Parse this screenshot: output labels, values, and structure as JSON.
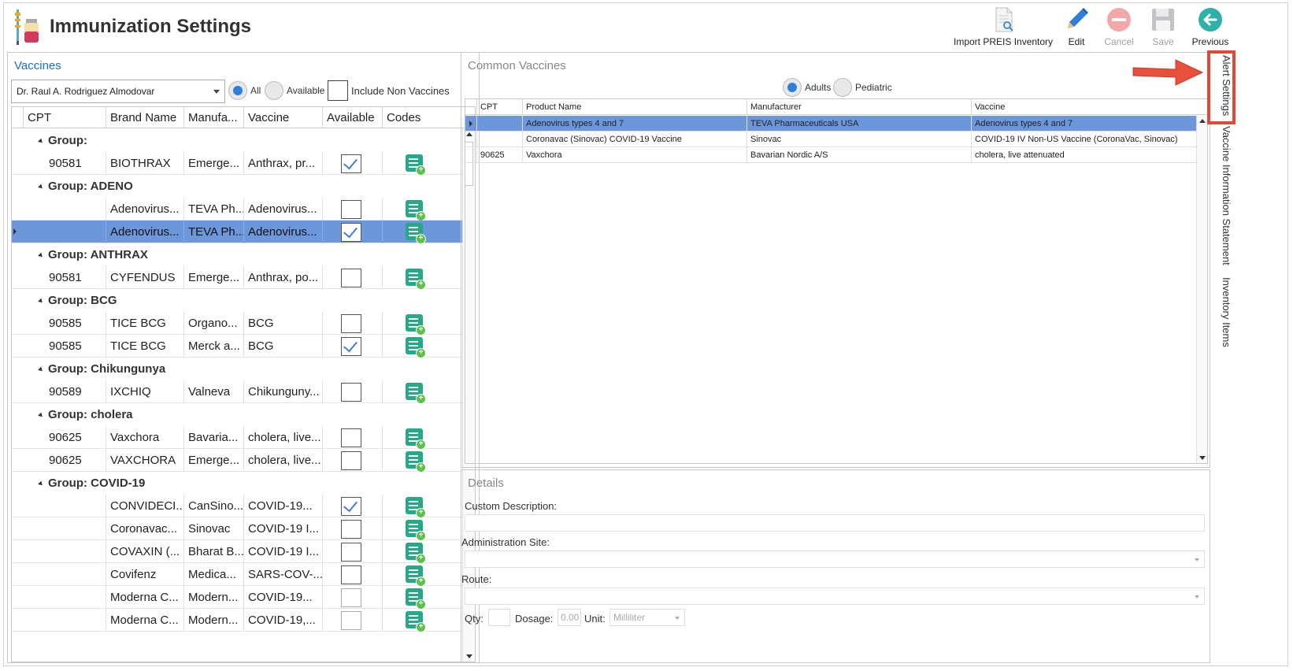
{
  "header": {
    "title": "Immunization Settings",
    "toolbar": [
      {
        "id": "import",
        "label": "Import PREIS Inventory",
        "icon": "document-search-icon",
        "enabled": true
      },
      {
        "id": "edit",
        "label": "Edit",
        "icon": "pencil-icon",
        "enabled": true
      },
      {
        "id": "cancel",
        "label": "Cancel",
        "icon": "cancel-icon",
        "enabled": false
      },
      {
        "id": "save",
        "label": "Save",
        "icon": "floppy-disk-icon",
        "enabled": false
      },
      {
        "id": "previous",
        "label": "Previous",
        "icon": "back-arrow-icon",
        "enabled": true
      }
    ]
  },
  "vaccines": {
    "title": "Vaccines",
    "provider": "Dr. Raul A. Rodriguez Almodovar",
    "filter": {
      "all": "All",
      "available": "Available",
      "selected": "All"
    },
    "include_non_vaccines": "Include Non Vaccines",
    "columns": [
      "CPT",
      "Brand Name",
      "Manufa...",
      "Vaccine",
      "Available",
      "Codes"
    ],
    "rows": [
      {
        "group": "Group:"
      },
      {
        "cpt": "90581",
        "brand": "BIOTHRAX",
        "manu": "Emerge...",
        "vaccine": "Anthrax, pr...",
        "available": true
      },
      {
        "group": "Group: ADENO"
      },
      {
        "cpt": "",
        "brand": "Adenovirus...",
        "manu": "TEVA Ph...",
        "vaccine": "Adenovirus...",
        "available": false
      },
      {
        "cpt": "",
        "brand": "Adenovirus...",
        "manu": "TEVA Ph...",
        "vaccine": "Adenovirus...",
        "available": true,
        "selected": true
      },
      {
        "group": "Group: ANTHRAX"
      },
      {
        "cpt": "90581",
        "brand": "CYFENDUS",
        "manu": "Emerge...",
        "vaccine": "Anthrax, po...",
        "available": false
      },
      {
        "group": "Group: BCG"
      },
      {
        "cpt": "90585",
        "brand": "TICE BCG",
        "manu": "Organo...",
        "vaccine": "BCG",
        "available": false
      },
      {
        "cpt": "90585",
        "brand": "TICE BCG",
        "manu": "Merck a...",
        "vaccine": "BCG",
        "available": true
      },
      {
        "group": "Group: Chikungunya"
      },
      {
        "cpt": "90589",
        "brand": "IXCHIQ",
        "manu": "Valneva",
        "vaccine": "Chikunguny...",
        "available": false
      },
      {
        "group": "Group: cholera"
      },
      {
        "cpt": "90625",
        "brand": "Vaxchora",
        "manu": "Bavaria...",
        "vaccine": "cholera, live...",
        "available": false
      },
      {
        "cpt": "90625",
        "brand": "VAXCHORA",
        "manu": "Emerge...",
        "vaccine": "cholera, live...",
        "available": false
      },
      {
        "group": "Group: COVID-19"
      },
      {
        "cpt": "",
        "brand": "CONVIDECI...",
        "manu": "CanSino...",
        "vaccine": "COVID-19...",
        "available": true
      },
      {
        "cpt": "",
        "brand": "Coronavac...",
        "manu": "Sinovac",
        "vaccine": "COVID-19 I...",
        "available": false
      },
      {
        "cpt": "",
        "brand": "COVAXIN (...",
        "manu": "Bharat B...",
        "vaccine": "COVID-19 I...",
        "available": false
      },
      {
        "cpt": "",
        "brand": "Covifenz",
        "manu": "Medica...",
        "vaccine": "SARS-COV-...",
        "available": false
      },
      {
        "cpt": "",
        "brand": "Moderna C...",
        "manu": "Modern...",
        "vaccine": "COVID-19...",
        "available": false,
        "dim": true
      },
      {
        "cpt": "",
        "brand": "Moderna C...",
        "manu": "Modern...",
        "vaccine": "COVID-19,...",
        "available": false,
        "dim": true
      }
    ]
  },
  "common": {
    "title": "Common Vaccines",
    "filter": {
      "adults": "Adults",
      "pediatric": "Pediatric",
      "selected": "Adults"
    },
    "columns": [
      "CPT",
      "Product Name",
      "Manufacturer",
      "Vaccine"
    ],
    "rows": [
      {
        "cpt": "",
        "product": "Adenovirus types 4 and 7",
        "manu": "TEVA Pharmaceuticals USA",
        "vaccine": "Adenovirus types 4 and 7",
        "selected": true
      },
      {
        "cpt": "",
        "product": "Coronavac (Sinovac) COVID-19 Vaccine",
        "manu": "Sinovac",
        "vaccine": "COVID-19 IV Non-US Vaccine (CoronaVac, Sinovac)"
      },
      {
        "cpt": "90625",
        "product": "Vaxchora",
        "manu": "Bavarian Nordic A/S",
        "vaccine": "cholera, live attenuated"
      }
    ]
  },
  "details": {
    "title": "Details",
    "custom_description": "Custom Description:",
    "administration_site": "Administration Site:",
    "route": "Route:",
    "qty": "Qty:",
    "dosage": "Dosage:",
    "dosage_value": "0.00",
    "unit": "Unit:",
    "unit_value": "Milliliter"
  },
  "side_tabs": [
    "Alert Settings",
    "Vaccine Information Statement",
    "Inventory Items"
  ],
  "colors": {
    "accent": "#1f6fd0",
    "selected_row": "#6c97da",
    "codes_icon": "#26a889",
    "annotation": "#e04838"
  }
}
